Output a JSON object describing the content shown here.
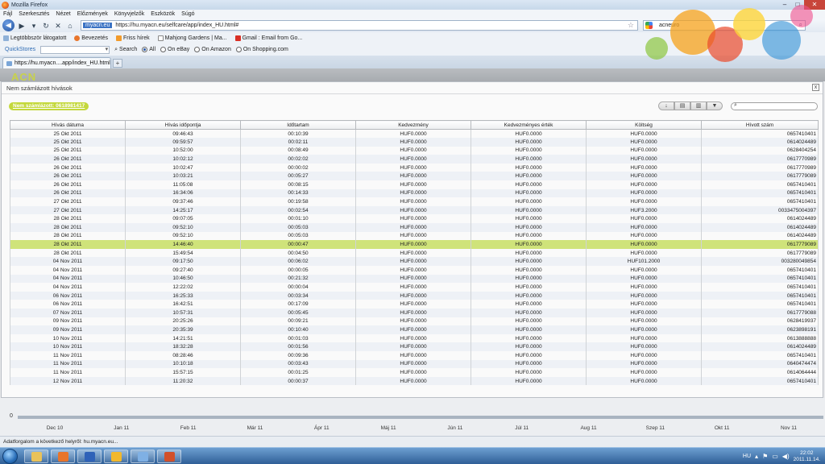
{
  "window": {
    "title": "Mozilla Firefox"
  },
  "menu": [
    "Fájl",
    "Szerkesztés",
    "Nézet",
    "Előzmények",
    "Könyvjelzők",
    "Eszközök",
    "Súgó"
  ],
  "nav": {
    "url_domain": "myacn.eu",
    "url": "https://hu.myacn.eu/selfcare/app/index_HU.html#",
    "search_value": "acneuro"
  },
  "bookmarks": [
    "Legtöbbször látogatott",
    "Bevezetés",
    "Friss hírek",
    "Mahjong Gardens | Ma...",
    "Gmail : Email from Go..."
  ],
  "quickstores": {
    "label": "QuickStores",
    "search_label": "Search",
    "options": [
      "All",
      "On eBay",
      "On Amazon",
      "On Shopping.com"
    ]
  },
  "tab": {
    "title": "https://hu.myacn....app/index_HU.html",
    "new_tab": "+"
  },
  "site": {
    "logo": "ACN"
  },
  "modal": {
    "title": "Nem számlázott hívások",
    "close": "x",
    "badge": "Nem számlázott: 0618981417",
    "tools": [
      "↓",
      "▤",
      "▥",
      "▼"
    ],
    "search_icon": "search-icon"
  },
  "table": {
    "columns": [
      "Hívás dátuma",
      "Hívás időpontja",
      "Időtartam",
      "Kedvezmény",
      "Kedvezményes érték",
      "Költség",
      "Hívott szám"
    ],
    "selected_row": 13,
    "rows": [
      [
        "25 Okt 2011",
        "09:46:43",
        "00:10:39",
        "HUF0.0000",
        "HUF0.0000",
        "HUF0.0000",
        "0657410401"
      ],
      [
        "25 Okt 2011",
        "09:59:57",
        "00:02:11",
        "HUF0.0000",
        "HUF0.0000",
        "HUF0.0000",
        "0614024489"
      ],
      [
        "25 Okt 2011",
        "10:52:00",
        "00:08:49",
        "HUF0.0000",
        "HUF0.0000",
        "HUF0.0000",
        "0628404254"
      ],
      [
        "26 Okt 2011",
        "10:02:12",
        "00:02:02",
        "HUF0.0000",
        "HUF0.0000",
        "HUF0.0000",
        "0617770989"
      ],
      [
        "26 Okt 2011",
        "10:02:47",
        "00:00:02",
        "HUF0.0000",
        "HUF0.0000",
        "HUF0.0000",
        "0617770989"
      ],
      [
        "26 Okt 2011",
        "10:03:21",
        "00:05:27",
        "HUF0.0000",
        "HUF0.0000",
        "HUF0.0000",
        "0617779089"
      ],
      [
        "26 Okt 2011",
        "11:05:08",
        "00:08:15",
        "HUF0.0000",
        "HUF0.0000",
        "HUF0.0000",
        "0657410401"
      ],
      [
        "26 Okt 2011",
        "16:34:06",
        "00:14:33",
        "HUF0.0000",
        "HUF0.0000",
        "HUF0.0000",
        "0657410401"
      ],
      [
        "27 Okt 2011",
        "09:37:46",
        "00:19:58",
        "HUF0.0000",
        "HUF0.0000",
        "HUF0.0000",
        "0657410401"
      ],
      [
        "27 Okt 2011",
        "14:25:17",
        "00:02:54",
        "HUF0.0000",
        "HUF0.0000",
        "HUF3.2000",
        "0033475004397"
      ],
      [
        "28 Okt 2011",
        "09:07:05",
        "00:01:10",
        "HUF0.0000",
        "HUF0.0000",
        "HUF0.0000",
        "0614024489"
      ],
      [
        "28 Okt 2011",
        "09:52:10",
        "00:05:03",
        "HUF0.0000",
        "HUF0.0000",
        "HUF0.0000",
        "0614024489"
      ],
      [
        "28 Okt 2011",
        "09:52:10",
        "00:05:03",
        "HUF0.0000",
        "HUF0.0000",
        "HUF0.0000",
        "0614024489"
      ],
      [
        "28 Okt 2011",
        "14:46:40",
        "00:00:47",
        "HUF0.0000",
        "HUF0.0000",
        "HUF0.0000",
        "0617779089"
      ],
      [
        "28 Okt 2011",
        "15:49:54",
        "00:04:50",
        "HUF0.0000",
        "HUF0.0000",
        "HUF0.0000",
        "0617779089"
      ],
      [
        "04 Nov 2011",
        "09:17:50",
        "00:06:02",
        "HUF0.0000",
        "HUF0.0000",
        "HUF101.2000",
        "003280049854"
      ],
      [
        "04 Nov 2011",
        "09:27:40",
        "00:00:05",
        "HUF0.0000",
        "HUF0.0000",
        "HUF0.0000",
        "0657410401"
      ],
      [
        "04 Nov 2011",
        "10:46:50",
        "00:21:32",
        "HUF0.0000",
        "HUF0.0000",
        "HUF0.0000",
        "0657410401"
      ],
      [
        "04 Nov 2011",
        "12:22:02",
        "00:00:04",
        "HUF0.0000",
        "HUF0.0000",
        "HUF0.0000",
        "0657410401"
      ],
      [
        "06 Nov 2011",
        "16:25:33",
        "00:03:34",
        "HUF0.0000",
        "HUF0.0000",
        "HUF0.0000",
        "0657410401"
      ],
      [
        "06 Nov 2011",
        "16:42:51",
        "00:17:09",
        "HUF0.0000",
        "HUF0.0000",
        "HUF0.0000",
        "0657410401"
      ],
      [
        "07 Nov 2011",
        "10:57:31",
        "00:05:45",
        "HUF0.0000",
        "HUF0.0000",
        "HUF0.0000",
        "0617779088"
      ],
      [
        "09 Nov 2011",
        "20:25:26",
        "00:09:21",
        "HUF0.0000",
        "HUF0.0000",
        "HUF0.0000",
        "0628419937"
      ],
      [
        "09 Nov 2011",
        "20:35:39",
        "00:10:40",
        "HUF0.0000",
        "HUF0.0000",
        "HUF0.0000",
        "0623898191"
      ],
      [
        "10 Nov 2011",
        "14:21:51",
        "00:01:03",
        "HUF0.0000",
        "HUF0.0000",
        "HUF0.0000",
        "0613888888"
      ],
      [
        "10 Nov 2011",
        "18:32:28",
        "00:01:56",
        "HUF0.0000",
        "HUF0.0000",
        "HUF0.0000",
        "0614024489"
      ],
      [
        "11 Nov 2011",
        "08:28:46",
        "00:09:36",
        "HUF0.0000",
        "HUF0.0000",
        "HUF0.0000",
        "0657410401"
      ],
      [
        "11 Nov 2011",
        "10:10:18",
        "00:03:43",
        "HUF0.0000",
        "HUF0.0000",
        "HUF0.0000",
        "0640474474"
      ],
      [
        "11 Nov 2011",
        "15:57:15",
        "00:01:25",
        "HUF0.0000",
        "HUF0.0000",
        "HUF0.0000",
        "0614064444"
      ],
      [
        "12 Nov 2011",
        "11:20:32",
        "00:00:37",
        "HUF0.0000",
        "HUF0.0000",
        "HUF0.0000",
        "0657410401"
      ]
    ]
  },
  "timeline": {
    "zero": "0",
    "months": [
      "Dec 10",
      "Jan 11",
      "Feb 11",
      "Már 11",
      "Ápr 11",
      "Máj 11",
      "Jún 11",
      "Júl 11",
      "Aug 11",
      "Szep 11",
      "Okt 11",
      "Nov 11"
    ]
  },
  "status": {
    "text": "Adatforgalom a következő helyről: hu.myacn.eu..."
  },
  "taskbar": {
    "lang": "HU",
    "time": "22:02",
    "date": "2011.11.14.",
    "apps": [
      {
        "name": "explorer",
        "color": "#e9c25a"
      },
      {
        "name": "firefox",
        "color": "#e8752b"
      },
      {
        "name": "word",
        "color": "#2f62b8"
      },
      {
        "name": "outlook",
        "color": "#f1b82d"
      },
      {
        "name": "paint",
        "color": "#7fb0e4"
      },
      {
        "name": "powerpoint",
        "color": "#d2502a"
      }
    ]
  }
}
